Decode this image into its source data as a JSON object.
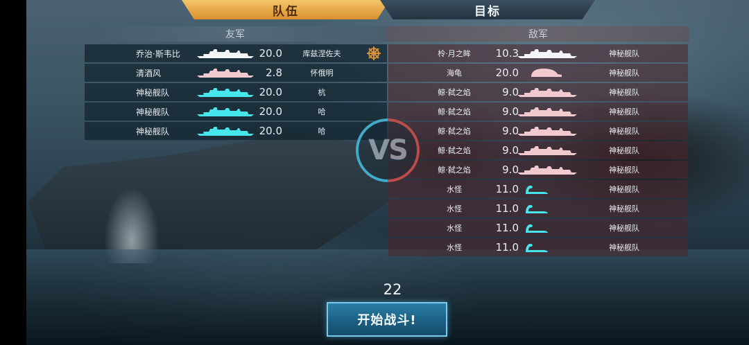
{
  "tabs": {
    "team_label": "队伍",
    "target_label": "目标"
  },
  "friendly": {
    "header": "友军",
    "rows": [
      {
        "name": "乔治·斯韦比",
        "level": "20.0",
        "captain": "库兹涅佐夫",
        "ship_color": "#f4f6f8",
        "icon": "ship-silhouette-icon"
      },
      {
        "name": "清酒风",
        "level": "2.8",
        "captain": "怀俄明",
        "ship_color": "#f1c9cf",
        "icon": "ship-silhouette-icon"
      },
      {
        "name": "神秘舰队",
        "level": "20.0",
        "captain": "杭",
        "ship_color": "#47e5ec",
        "icon": "ship-silhouette-icon"
      },
      {
        "name": "神秘舰队",
        "level": "20.0",
        "captain": "哈",
        "ship_color": "#47e5ec",
        "icon": "ship-silhouette-icon"
      },
      {
        "name": "神秘舰队",
        "level": "20.0",
        "captain": "哈",
        "ship_color": "#47e5ec",
        "icon": "ship-silhouette-icon"
      }
    ],
    "commander_icon": "ship-wheel-icon"
  },
  "enemy": {
    "header": "敌军",
    "rows": [
      {
        "name": "柃·月之眸",
        "level": "10.3",
        "fleet": "神秘舰队",
        "ship_color": "#f4f6f8",
        "icon": "ship-silhouette-icon"
      },
      {
        "name": "海龟",
        "level": "20.0",
        "fleet": "神秘舰队",
        "ship_color": "#f1c9cf",
        "icon": "turtle-silhouette-icon"
      },
      {
        "name": "鲸·弑之焰",
        "level": "9.0",
        "fleet": "神秘舰队",
        "ship_color": "#f1c9cf",
        "icon": "ship-silhouette-icon"
      },
      {
        "name": "鲸·弑之焰",
        "level": "9.0",
        "fleet": "神秘舰队",
        "ship_color": "#f1c9cf",
        "icon": "ship-silhouette-icon"
      },
      {
        "name": "鲸·弑之焰",
        "level": "9.0",
        "fleet": "神秘舰队",
        "ship_color": "#f1c9cf",
        "icon": "ship-silhouette-icon"
      },
      {
        "name": "鲸·弑之焰",
        "level": "9.0",
        "fleet": "神秘舰队",
        "ship_color": "#f1c9cf",
        "icon": "ship-silhouette-icon"
      },
      {
        "name": "鲸·弑之焰",
        "level": "9.0",
        "fleet": "神秘舰队",
        "ship_color": "#f1c9cf",
        "icon": "ship-silhouette-icon"
      },
      {
        "name": "水怪",
        "level": "11.0",
        "fleet": "神秘舰队",
        "ship_color": "#47e5ec",
        "icon": "sea-monster-icon"
      },
      {
        "name": "水怪",
        "level": "11.0",
        "fleet": "神秘舰队",
        "ship_color": "#47e5ec",
        "icon": "sea-monster-icon"
      },
      {
        "name": "水怪",
        "level": "11.0",
        "fleet": "神秘舰队",
        "ship_color": "#47e5ec",
        "icon": "sea-monster-icon"
      },
      {
        "name": "水怪",
        "level": "11.0",
        "fleet": "神秘舰队",
        "ship_color": "#47e5ec",
        "icon": "sea-monster-icon"
      }
    ]
  },
  "versus": {
    "label": "VS"
  },
  "countdown": "22",
  "start_button": {
    "label": "开始战斗!"
  }
}
